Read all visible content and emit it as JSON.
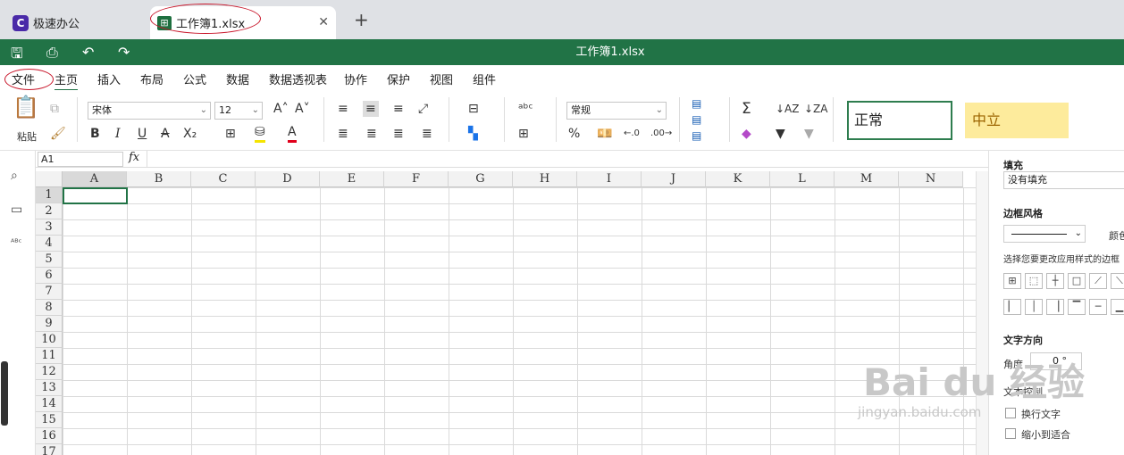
{
  "tabs": [
    {
      "label": "极速办公",
      "logo": "C"
    },
    {
      "label": "工作簿1.xlsx",
      "logo": "⊞",
      "close": "✕"
    }
  ],
  "new_tab": "+",
  "titlebar": {
    "title": "工作簿1.xlsx"
  },
  "menu": [
    "文件",
    "主页",
    "插入",
    "布局",
    "公式",
    "数据",
    "数据透视表",
    "协作",
    "保护",
    "视图",
    "组件"
  ],
  "ribbon": {
    "paste_label": "粘贴",
    "font_name": "宋体",
    "font_size": "12",
    "bold": "B",
    "italic": "I",
    "underline": "U",
    "strike": "A",
    "subscript": "X₂",
    "number_format": "常规",
    "percent": "%",
    "sum": "Σ",
    "style_normal": "正常",
    "style_neutral": "中立"
  },
  "formula_bar": {
    "cell_ref": "A1",
    "fx": "fx",
    "value": ""
  },
  "columns": [
    "A",
    "B",
    "C",
    "D",
    "E",
    "F",
    "G",
    "H",
    "I",
    "J",
    "K",
    "L",
    "M",
    "N"
  ],
  "rows": [
    "1",
    "2",
    "3",
    "4",
    "5",
    "6",
    "7",
    "8",
    "9",
    "10",
    "11",
    "12",
    "13",
    "14",
    "15",
    "16",
    "17"
  ],
  "right_panel": {
    "fill_label": "填充",
    "fill_value": "没有填充",
    "border_style_label": "边框风格",
    "border_color_label": "颜色",
    "border_hint": "选择您要更改应用样式的边框",
    "text_direction_label": "文字方向",
    "angle_label": "角度",
    "angle_value": "0 °",
    "text_control_label": "文本控制",
    "wrap_label": "换行文字",
    "shrink_label": "缩小到适合"
  },
  "watermark": {
    "main": "Bai du 经验",
    "sub": "jingyan.baidu.com"
  },
  "colors": {
    "brand": "#217346",
    "ellipse": "#c8162a",
    "neutral_bg": "#fdeb9c"
  }
}
